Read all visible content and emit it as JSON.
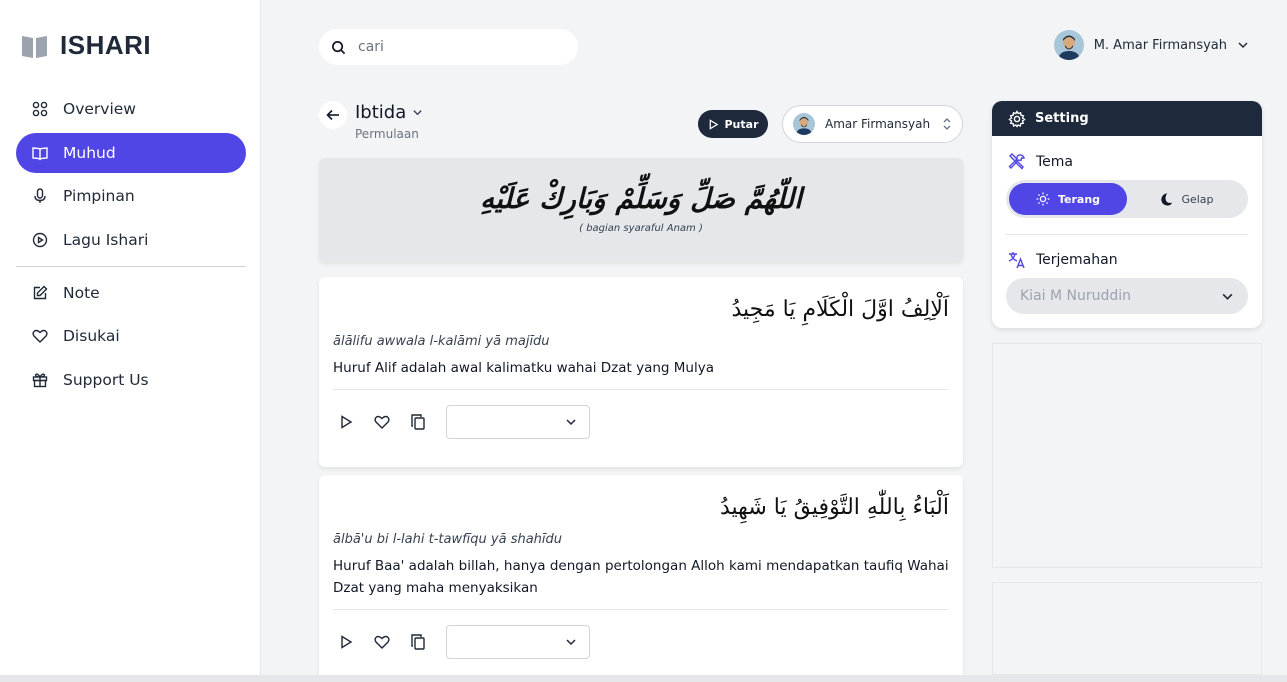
{
  "app": {
    "brand": "ISHARI"
  },
  "sidebar": {
    "items": [
      {
        "label": "Overview",
        "icon": "grid-icon",
        "active": false
      },
      {
        "label": "Muhud",
        "icon": "book-icon",
        "active": true
      },
      {
        "label": "Pimpinan",
        "icon": "microphone-icon",
        "active": false
      },
      {
        "label": "Lagu Ishari",
        "icon": "play-circle-icon",
        "active": false
      }
    ],
    "items2": [
      {
        "label": "Note",
        "icon": "edit-icon"
      },
      {
        "label": "Disukai",
        "icon": "heart-icon"
      },
      {
        "label": "Support Us",
        "icon": "gift-icon"
      }
    ]
  },
  "search": {
    "placeholder": "cari",
    "value": ""
  },
  "user": {
    "name": "M. Amar Firmansyah"
  },
  "page": {
    "title": "Ibtida",
    "subtitle": "Permulaan",
    "play_label": "Putar",
    "reciter": "Amar Firmansyah"
  },
  "banner": {
    "arabic": "اللّهُمَّ صَلِّ وَسَلِّمْ وَبَارِكْ عَلَيْهِ",
    "caption": "( bagian syaraful Anam )"
  },
  "verses": [
    {
      "arabic": "اَلْاِلِفُ اوَّلَ الْكَلَامِ يَا مَجِيدُ",
      "latin": "ālālifu awwala l-kalāmi yā majīdu",
      "translation": "Huruf Alif adalah awal kalimatku wahai Dzat yang Mulya"
    },
    {
      "arabic": "اَلْبَاءُ بِاللّٰهِ التَّوْفِيقُ يَا شَهِيدُ",
      "latin": "ālbā'u bi l-lahi t-tawfīqu yā shahīdu",
      "translation": "Huruf Baa' adalah billah, hanya dengan pertolongan Alloh kami mendapatkan taufiq Wahai Dzat yang maha menyaksikan"
    }
  ],
  "setting": {
    "title": "Setting",
    "theme_label": "Tema",
    "theme_light": "Terang",
    "theme_dark": "Gelap",
    "theme_selected": "Terang",
    "translation_label": "Terjemahan",
    "translation_value": "Kiai M Nuruddin"
  },
  "colors": {
    "accent": "#5046e5",
    "dark": "#1e293b",
    "background": "#f3f4f6"
  }
}
